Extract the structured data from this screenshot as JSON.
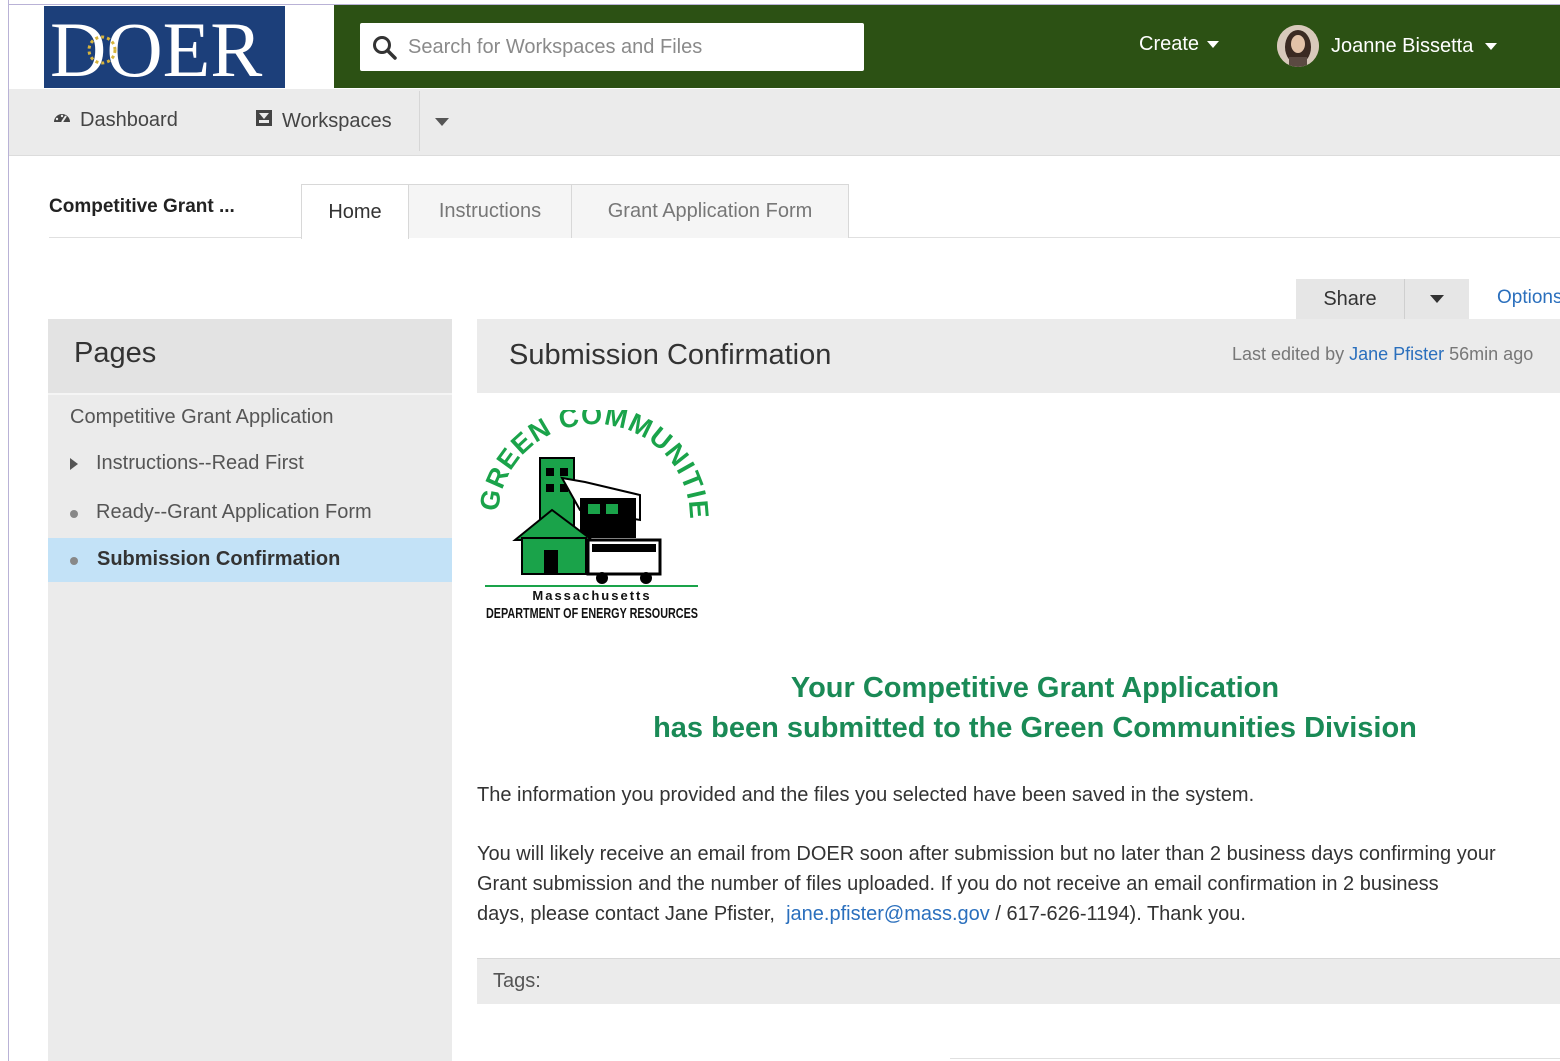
{
  "brand": {
    "logo_text": "DOER",
    "header_color": "#2c5114",
    "logo_bg": "#1c3f7a"
  },
  "search": {
    "placeholder": "Search for Workspaces and Files"
  },
  "header": {
    "create_label": "Create",
    "user_name": "Joanne Bissetta"
  },
  "nav": {
    "dashboard_label": "Dashboard",
    "workspaces_label": "Workspaces"
  },
  "workspace": {
    "title": "Competitive Grant ...",
    "tabs": [
      {
        "label": "Home",
        "active": true
      },
      {
        "label": "Instructions",
        "active": false
      },
      {
        "label": "Grant Application Form",
        "active": false
      }
    ]
  },
  "actions": {
    "share_label": "Share",
    "options_label": "Options"
  },
  "sidebar": {
    "heading": "Pages",
    "items": [
      {
        "label": "Competitive Grant Application",
        "marker": "none"
      },
      {
        "label": "Instructions--Read First",
        "marker": "triangle"
      },
      {
        "label": "Ready--Grant Application Form",
        "marker": "bullet"
      },
      {
        "label": "Submission Confirmation",
        "marker": "bullet",
        "selected": true
      }
    ]
  },
  "page": {
    "title": "Submission Confirmation",
    "last_edited_prefix": "Last edited by",
    "last_edited_user": "Jane Pfister",
    "last_edited_time": "56min ago",
    "logo": {
      "arc_text": "GREEN COMMUNITIES",
      "state": "Massachusetts",
      "department": "DEPARTMENT OF ENERGY RESOURCES",
      "color": "#1aa34a"
    },
    "headline_line1": "Your Competitive Grant Application",
    "headline_line2": "has been submitted to the Green Communities Division",
    "para1": "The information you provided and the files you selected have been saved in the system.",
    "para2_line1": "You will likely receive an email from DOER soon after submission but no later than 2 business days confirming your",
    "para2_line2": "Grant submission and the number of files uploaded. If you do not receive an email confirmation in 2 business",
    "para2_line3_pre": "days, please contact Jane Pfister,",
    "para2_email": "jane.pfister@mass.gov",
    "para2_line3_post": "/ 617-626-1194). Thank you.",
    "tags_label": "Tags:"
  }
}
